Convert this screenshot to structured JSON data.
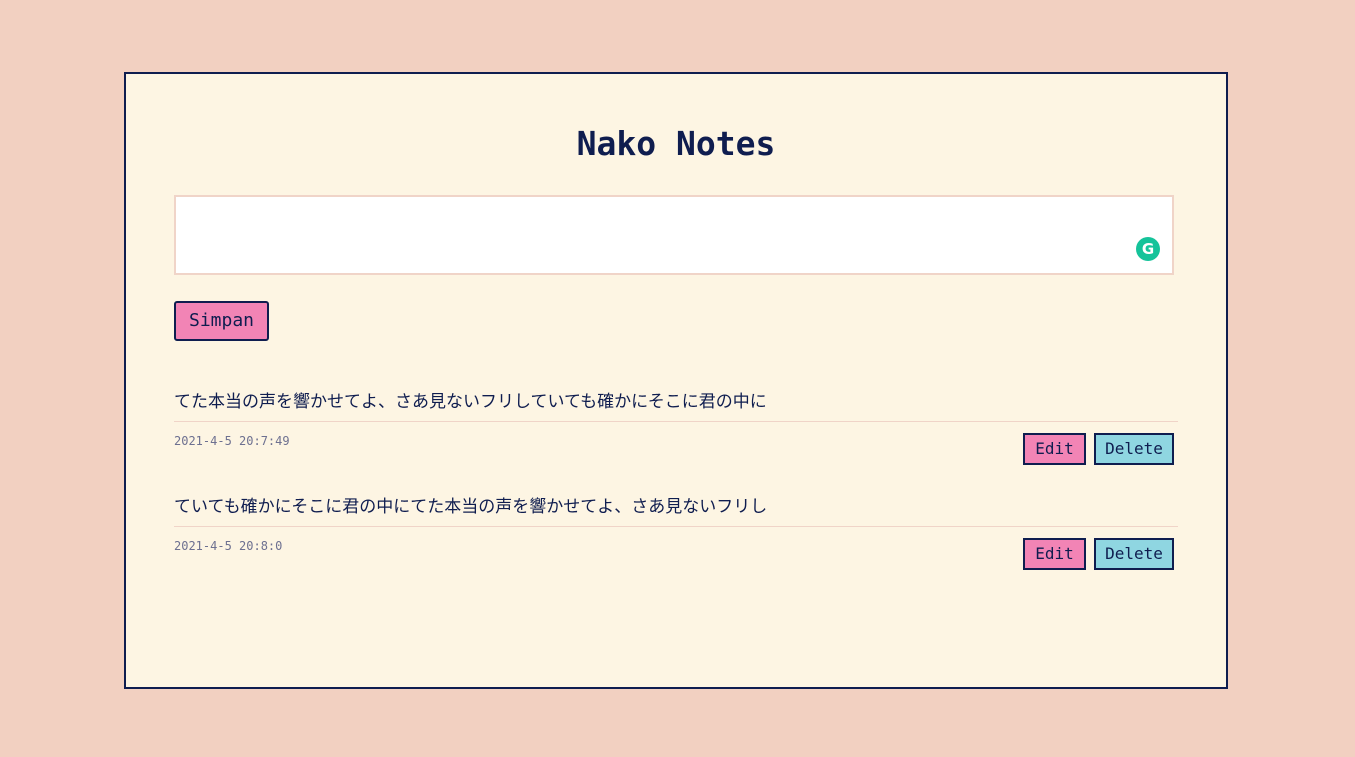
{
  "app": {
    "title": "Nako Notes"
  },
  "editor": {
    "value": "",
    "placeholder": "",
    "grammarly_icon": "grammarly-g-icon",
    "grammarly_glyph": "G"
  },
  "actions": {
    "save_label": "Simpan"
  },
  "notes": [
    {
      "text": "てた本当の声を響かせてよ、さあ見ないフリしていても確かにそこに君の中に",
      "timestamp": "2021-4-5 20:7:49",
      "edit_label": "Edit",
      "delete_label": "Delete"
    },
    {
      "text": "ていても確かにそこに君の中にてた本当の声を響かせてよ、さあ見ないフリし",
      "timestamp": "2021-4-5 20:8:0",
      "edit_label": "Edit",
      "delete_label": "Delete"
    }
  ],
  "colors": {
    "page_background": "#f2d0c1",
    "card_background": "#fdf5e3",
    "ink": "#0f1d4f",
    "pink_button": "#f284b5",
    "cyan_button": "#8fd6e1",
    "grammarly_green": "#15c39a"
  }
}
